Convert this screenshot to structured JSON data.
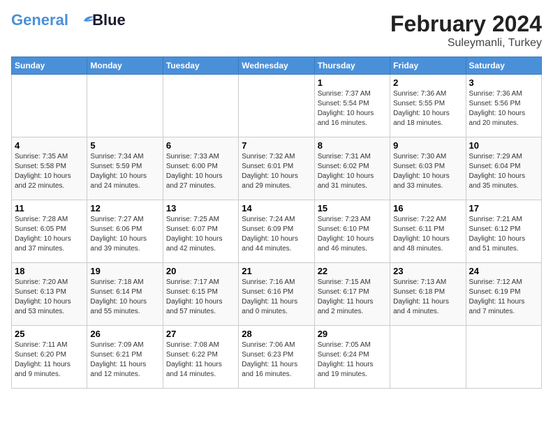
{
  "header": {
    "logo_line1": "General",
    "logo_line2": "Blue",
    "month_title": "February 2024",
    "subtitle": "Suleymanli, Turkey"
  },
  "weekdays": [
    "Sunday",
    "Monday",
    "Tuesday",
    "Wednesday",
    "Thursday",
    "Friday",
    "Saturday"
  ],
  "weeks": [
    [
      {
        "day": "",
        "info": ""
      },
      {
        "day": "",
        "info": ""
      },
      {
        "day": "",
        "info": ""
      },
      {
        "day": "",
        "info": ""
      },
      {
        "day": "1",
        "info": "Sunrise: 7:37 AM\nSunset: 5:54 PM\nDaylight: 10 hours\nand 16 minutes."
      },
      {
        "day": "2",
        "info": "Sunrise: 7:36 AM\nSunset: 5:55 PM\nDaylight: 10 hours\nand 18 minutes."
      },
      {
        "day": "3",
        "info": "Sunrise: 7:36 AM\nSunset: 5:56 PM\nDaylight: 10 hours\nand 20 minutes."
      }
    ],
    [
      {
        "day": "4",
        "info": "Sunrise: 7:35 AM\nSunset: 5:58 PM\nDaylight: 10 hours\nand 22 minutes."
      },
      {
        "day": "5",
        "info": "Sunrise: 7:34 AM\nSunset: 5:59 PM\nDaylight: 10 hours\nand 24 minutes."
      },
      {
        "day": "6",
        "info": "Sunrise: 7:33 AM\nSunset: 6:00 PM\nDaylight: 10 hours\nand 27 minutes."
      },
      {
        "day": "7",
        "info": "Sunrise: 7:32 AM\nSunset: 6:01 PM\nDaylight: 10 hours\nand 29 minutes."
      },
      {
        "day": "8",
        "info": "Sunrise: 7:31 AM\nSunset: 6:02 PM\nDaylight: 10 hours\nand 31 minutes."
      },
      {
        "day": "9",
        "info": "Sunrise: 7:30 AM\nSunset: 6:03 PM\nDaylight: 10 hours\nand 33 minutes."
      },
      {
        "day": "10",
        "info": "Sunrise: 7:29 AM\nSunset: 6:04 PM\nDaylight: 10 hours\nand 35 minutes."
      }
    ],
    [
      {
        "day": "11",
        "info": "Sunrise: 7:28 AM\nSunset: 6:05 PM\nDaylight: 10 hours\nand 37 minutes."
      },
      {
        "day": "12",
        "info": "Sunrise: 7:27 AM\nSunset: 6:06 PM\nDaylight: 10 hours\nand 39 minutes."
      },
      {
        "day": "13",
        "info": "Sunrise: 7:25 AM\nSunset: 6:07 PM\nDaylight: 10 hours\nand 42 minutes."
      },
      {
        "day": "14",
        "info": "Sunrise: 7:24 AM\nSunset: 6:09 PM\nDaylight: 10 hours\nand 44 minutes."
      },
      {
        "day": "15",
        "info": "Sunrise: 7:23 AM\nSunset: 6:10 PM\nDaylight: 10 hours\nand 46 minutes."
      },
      {
        "day": "16",
        "info": "Sunrise: 7:22 AM\nSunset: 6:11 PM\nDaylight: 10 hours\nand 48 minutes."
      },
      {
        "day": "17",
        "info": "Sunrise: 7:21 AM\nSunset: 6:12 PM\nDaylight: 10 hours\nand 51 minutes."
      }
    ],
    [
      {
        "day": "18",
        "info": "Sunrise: 7:20 AM\nSunset: 6:13 PM\nDaylight: 10 hours\nand 53 minutes."
      },
      {
        "day": "19",
        "info": "Sunrise: 7:18 AM\nSunset: 6:14 PM\nDaylight: 10 hours\nand 55 minutes."
      },
      {
        "day": "20",
        "info": "Sunrise: 7:17 AM\nSunset: 6:15 PM\nDaylight: 10 hours\nand 57 minutes."
      },
      {
        "day": "21",
        "info": "Sunrise: 7:16 AM\nSunset: 6:16 PM\nDaylight: 11 hours\nand 0 minutes."
      },
      {
        "day": "22",
        "info": "Sunrise: 7:15 AM\nSunset: 6:17 PM\nDaylight: 11 hours\nand 2 minutes."
      },
      {
        "day": "23",
        "info": "Sunrise: 7:13 AM\nSunset: 6:18 PM\nDaylight: 11 hours\nand 4 minutes."
      },
      {
        "day": "24",
        "info": "Sunrise: 7:12 AM\nSunset: 6:19 PM\nDaylight: 11 hours\nand 7 minutes."
      }
    ],
    [
      {
        "day": "25",
        "info": "Sunrise: 7:11 AM\nSunset: 6:20 PM\nDaylight: 11 hours\nand 9 minutes."
      },
      {
        "day": "26",
        "info": "Sunrise: 7:09 AM\nSunset: 6:21 PM\nDaylight: 11 hours\nand 12 minutes."
      },
      {
        "day": "27",
        "info": "Sunrise: 7:08 AM\nSunset: 6:22 PM\nDaylight: 11 hours\nand 14 minutes."
      },
      {
        "day": "28",
        "info": "Sunrise: 7:06 AM\nSunset: 6:23 PM\nDaylight: 11 hours\nand 16 minutes."
      },
      {
        "day": "29",
        "info": "Sunrise: 7:05 AM\nSunset: 6:24 PM\nDaylight: 11 hours\nand 19 minutes."
      },
      {
        "day": "",
        "info": ""
      },
      {
        "day": "",
        "info": ""
      }
    ]
  ]
}
